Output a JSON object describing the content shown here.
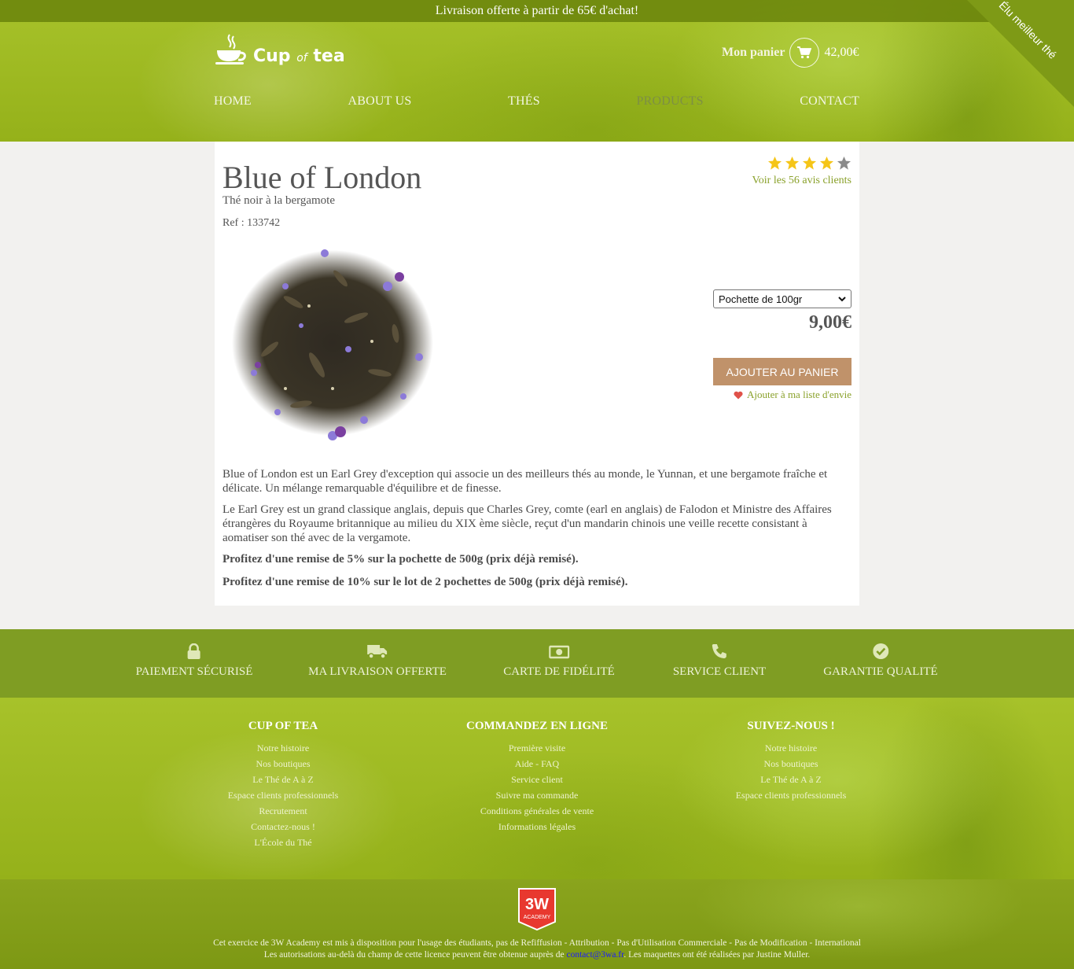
{
  "topbar": {
    "text": "Livraison offerte à partir de 65€ d'achat!"
  },
  "ribbon": {
    "text": "Élu meilleur thé"
  },
  "brand": {
    "name_a": "Cup",
    "name_of": "of",
    "name_b": "tea"
  },
  "cart": {
    "label": "Mon panier",
    "total": "42,00€"
  },
  "nav": {
    "items": [
      {
        "label": "HOME"
      },
      {
        "label": "ABOUT US"
      },
      {
        "label": "THÉS"
      },
      {
        "label": "PRODUCTS"
      },
      {
        "label": "CONTACT"
      }
    ],
    "active": "PRODUCTS"
  },
  "product": {
    "title": "Blue of London",
    "subtitle": "Thé noir à la bergamote",
    "ref": "Ref : 133742",
    "rating": {
      "value": 4,
      "max": 5,
      "reviews_link": "Voir les 56 avis clients"
    },
    "format_option": "Pochette de 100gr",
    "price": "9,00€",
    "add_to_cart": "AJOUTER AU PANIER",
    "wishlist": "Ajouter à ma liste d'envie",
    "description": [
      "Blue of London est un Earl Grey d'exception qui associe un des meilleurs thés au monde, le Yunnan, et une bergamote fraîche et délicate. Un mélange remarquable d'équilibre et de finesse.",
      "Le Earl Grey est un grand classique anglais, depuis que Charles Grey, comte (earl en anglais) de Falodon et Ministre des Affaires étrangères du Royaume britannique au milieu du XIX ème siècle, reçut d'un mandarin chinois une veille recette consistant à aomatiser son thé avec de la vergamote."
    ],
    "offers": [
      "Profitez d'une remise de 5% sur la pochette de 500g (prix déjà remisé).",
      "Profitez d'une remise de 10% sur le lot de 2 pochettes de 500g (prix déjà remisé)."
    ]
  },
  "services": [
    {
      "label": "PAIEMENT SÉCURISÉ",
      "icon": "lock-icon"
    },
    {
      "label": "MA LIVRAISON OFFERTE",
      "icon": "truck-icon"
    },
    {
      "label": "CARTE DE FIDÉLITÉ",
      "icon": "money-icon"
    },
    {
      "label": "SERVICE CLIENT",
      "icon": "phone-icon"
    },
    {
      "label": "GARANTIE QUALITÉ",
      "icon": "check-circle-icon"
    }
  ],
  "footer": {
    "col1": {
      "title": "CUP OF TEA",
      "links": [
        "Notre histoire",
        "Nos boutiques",
        "Le Thé de A à Z",
        "Espace clients professionnels",
        "Recrutement",
        "Contactez-nous !",
        "L'École du Thé"
      ]
    },
    "col2": {
      "title": "COMMANDEZ EN LIGNE",
      "links": [
        "Première visite",
        "Aide - FAQ",
        "Service client",
        "Suivre ma commande",
        "Conditions générales de vente",
        "Informations légales"
      ]
    },
    "col3": {
      "title": "SUIVEZ-NOUS !",
      "links": [
        "Notre histoire",
        "Nos boutiques",
        "Le Thé de A à Z",
        "Espace clients professionnels"
      ]
    }
  },
  "legal": {
    "logo_text": "3W",
    "logo_sub": "ACADEMY",
    "line1": "Cet exercice de 3W Academy est mis à disposition pour l'usage des étudiants, pas de Refiffusion - Attribution - Pas d'Utilisation Commerciale - Pas de Modification - International",
    "line2_before": "Les autorisations au-delà du champ de cette licence peuvent être obtenue auprès de ",
    "email": "contact@3wa.fr",
    "line2_after": ". Les maquettes ont été réalisées par Justine Muller."
  },
  "colors": {
    "accent_green": "#8aa12b",
    "button": "#c0926a",
    "services_band": "#7f9d23",
    "star": "#f5c518",
    "star_empty": "#8a8a8a"
  }
}
